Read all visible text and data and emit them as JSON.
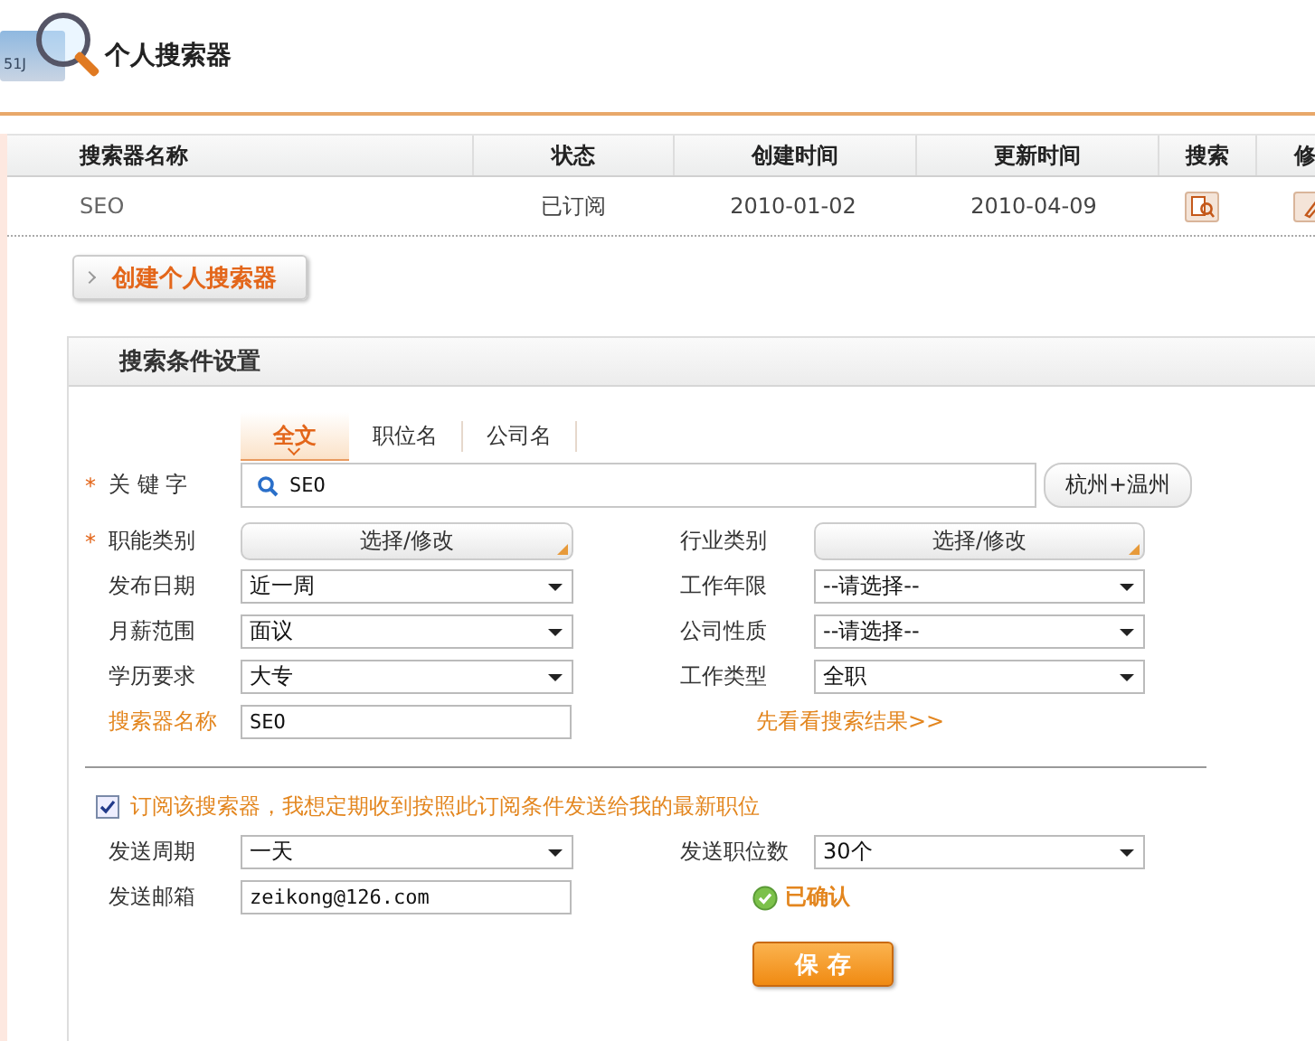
{
  "header": {
    "logo_text": "51J",
    "title": "个人搜索器"
  },
  "table": {
    "columns": [
      "搜索器名称",
      "状态",
      "创建时间",
      "更新时间",
      "搜索",
      "修"
    ],
    "rows": [
      {
        "cells": [
          {
            "kind": "text",
            "text": "SEO"
          },
          {
            "kind": "text",
            "text": "已订阅"
          },
          {
            "kind": "text",
            "text": "2010-01-02"
          },
          {
            "kind": "text",
            "text": "2010-04-09"
          },
          {
            "kind": "search_icon"
          },
          {
            "kind": "edit_icon"
          }
        ]
      }
    ]
  },
  "create_button": "创建个人搜索器",
  "panel": {
    "title": "搜索条件设置",
    "tabs": [
      {
        "label": "全文",
        "selected": true
      },
      {
        "label": "职位名",
        "selected": false
      },
      {
        "label": "公司名",
        "selected": false
      }
    ],
    "keyword": {
      "mark": "*",
      "label": "关 键 字",
      "value": "SEO",
      "city": "杭州+温州"
    },
    "rows": [
      {
        "left": {
          "mark": "*",
          "label": "职能类别",
          "kind": "picker",
          "value": "选择/修改"
        },
        "right": {
          "label": "行业类别",
          "kind": "picker",
          "value": "选择/修改"
        }
      },
      {
        "left": {
          "label": "发布日期",
          "kind": "select",
          "value": "近一周"
        },
        "right": {
          "label": "工作年限",
          "kind": "select",
          "value": "--请选择--"
        }
      },
      {
        "left": {
          "label": "月薪范围",
          "kind": "select",
          "value": "面议"
        },
        "right": {
          "label": "公司性质",
          "kind": "select",
          "value": "--请选择--"
        }
      },
      {
        "left": {
          "label": "学历要求",
          "kind": "select",
          "value": "大专"
        },
        "right": {
          "label": "工作类型",
          "kind": "select",
          "value": "全职"
        }
      },
      {
        "left": {
          "label": "搜索器名称",
          "highlight": true,
          "kind": "input",
          "value": "SEO"
        },
        "right": {
          "kind": "link",
          "value": "先看看搜索结果>>"
        }
      }
    ],
    "subscribe": {
      "checked": true,
      "label": "订阅该搜索器，我想定期收到按照此订阅条件发送给我的最新职位"
    },
    "sub_rows": [
      {
        "left": {
          "label": "发送周期",
          "kind": "select",
          "value": "一天"
        },
        "right": {
          "label": "发送职位数",
          "kind": "select",
          "value": "30个"
        }
      },
      {
        "left": {
          "label": "发送邮箱",
          "kind": "input",
          "value": "zeikong@126.com"
        },
        "right": {
          "kind": "status",
          "value": "已确认"
        }
      }
    ],
    "save_button": "保 存"
  }
}
